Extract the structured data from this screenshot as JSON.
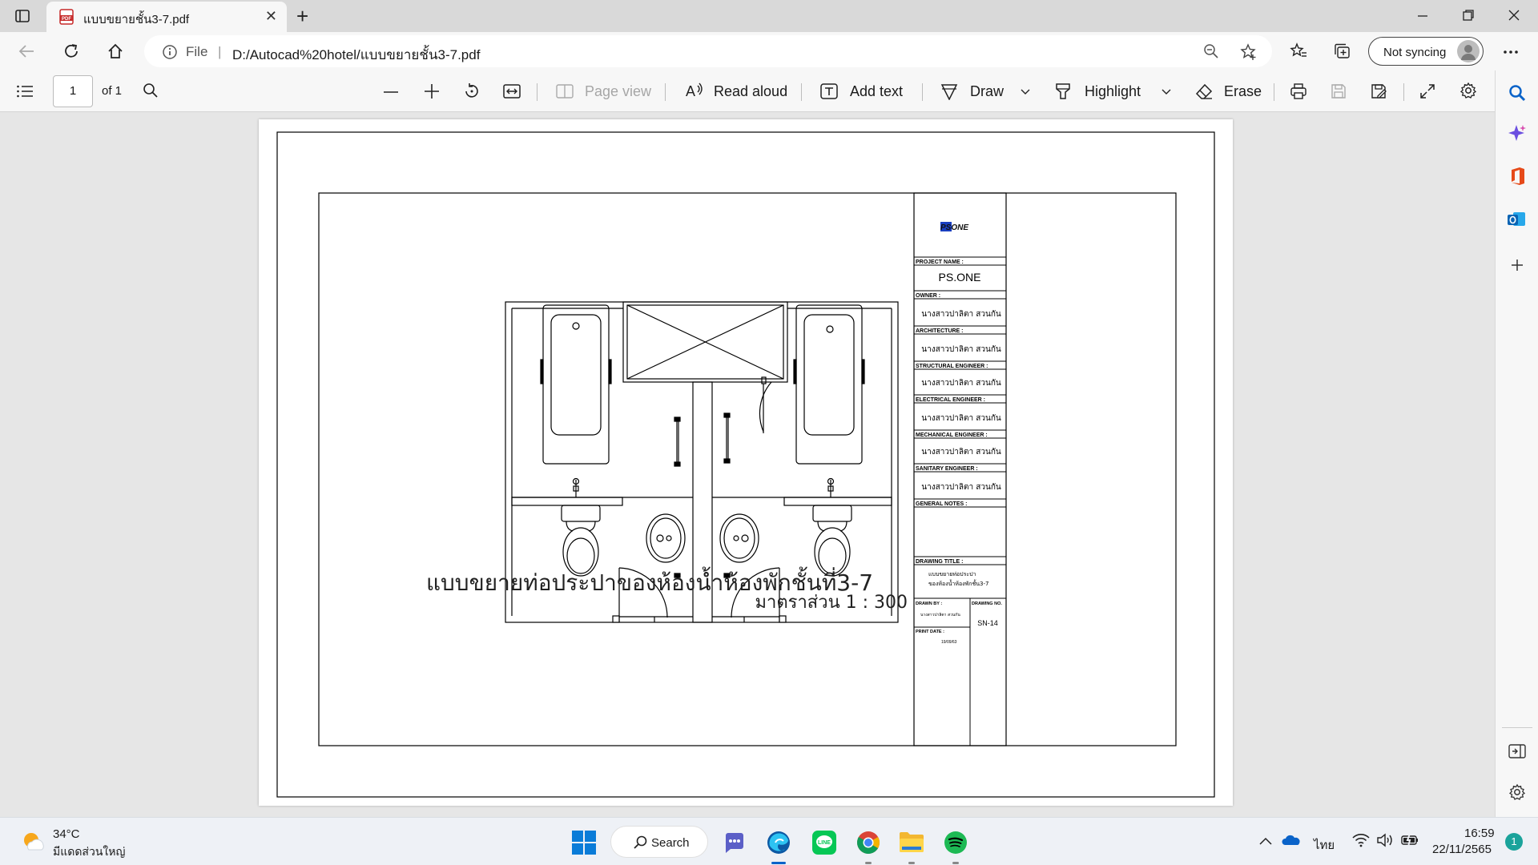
{
  "browser": {
    "tab_title": "แบบขยายชั้น3-7.pdf",
    "new_tab_symbol": "+",
    "close_symbol": "✕",
    "address_protocol": "File",
    "address_url": "D:/Autocad%20hotel/แบบขยายชั้น3-7.pdf",
    "profile_button": "Not syncing"
  },
  "pdf_toolbar": {
    "page_number": "1",
    "page_total": "of 1",
    "page_view": "Page view",
    "read_aloud": "Read aloud",
    "add_text": "Add text",
    "draw": "Draw",
    "highlight": "Highlight",
    "erase": "Erase"
  },
  "drawing": {
    "title": "แบบขยายท่อประปาของห้องน้ำห้องพักชั้นที่3-7",
    "scale": "มาตราส่วน 1 : 300"
  },
  "title_block": {
    "logo": "PSONE",
    "project_name_label": "PROJECT NAME :",
    "project_name": "PS.ONE",
    "owner_label": "OWNER :",
    "owner": "นางสาวปาลิตา สวนกัน",
    "architecture_label": "ARCHITECTURE :",
    "architecture": "นางสาวปาลิตา สวนกัน",
    "structural_label": "STRUCTURAL ENGINEER :",
    "structural": "นางสาวปาลิตา สวนกัน",
    "electrical_label": "ELECTRICAL ENGINEER :",
    "electrical": "นางสาวปาลิตา สวนกัน",
    "mechanical_label": "MECHANICAL ENGINEER :",
    "mechanical": "นางสาวปาลิตา สวนกัน",
    "sanitary_label": "SANITARY ENGINEER :",
    "sanitary": "นางสาวปาลิตา สวนกัน",
    "general_notes_label": "GENERAL NOTES :",
    "drawing_title_label": "DRAWING TITLE :",
    "drawing_title_line1": "แบบขยายท่อประปา",
    "drawing_title_line2": "ของห้องน้ำห้องพักชั้น3-7",
    "drawn_by_label": "DRAWN BY :",
    "drawn_by": "นางสาวปาลิตา สวนกัน",
    "drawing_no_label": "DRAWING NO.",
    "drawing_no": "SN-14",
    "print_date_label": "PRINT DATE :",
    "print_date": "19/09/63"
  },
  "taskbar": {
    "temperature": "34°C",
    "weather_condition": "มีแดดส่วนใหญ่",
    "search_label": "Search",
    "language": "ไทย",
    "time": "16:59",
    "date": "22/11/2565",
    "notification_count": "1"
  },
  "colors": {
    "edge_blue": "#0c59a4",
    "spotify_green": "#1db954",
    "line_green": "#06c755",
    "windows_blue": "#0a7cd8",
    "notification_teal": "#1aa39b"
  }
}
